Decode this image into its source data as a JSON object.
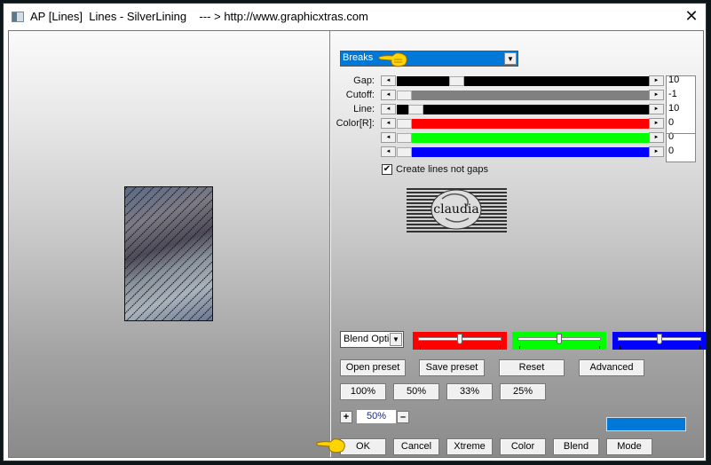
{
  "window": {
    "title": "AP [Lines]  Lines - SilverLining    --- > http://www.graphicxtras.com",
    "close_icon": "close-icon"
  },
  "mode": {
    "selected": "Breaks"
  },
  "sliders": [
    {
      "label": "Gap:",
      "value": "10",
      "fill_color": "#000000",
      "position": 0.22
    },
    {
      "label": "Cutoff:",
      "value": "-1",
      "fill_color": "#808080",
      "position": 0.0
    },
    {
      "label": "Line:",
      "value": "10",
      "fill_color": "#000000",
      "position": 0.05
    },
    {
      "label": "Color[R]:",
      "value": "0",
      "fill_color": "#ff0000",
      "position": 0.0
    },
    {
      "label": "",
      "value": "0",
      "fill_color": "#00ff00",
      "position": 0.0
    },
    {
      "label": "",
      "value": "0",
      "fill_color": "#0000ff",
      "position": 0.0
    }
  ],
  "checkbox": {
    "label": "Create lines not gaps",
    "checked": true
  },
  "logo": {
    "text": "claudia"
  },
  "blend": {
    "selected": "Blend Options",
    "color_sliders": [
      {
        "color": "#ff0000",
        "position": 0.5
      },
      {
        "color": "#00ff00",
        "position": 0.5
      },
      {
        "color": "#0000ff",
        "position": 0.5
      }
    ]
  },
  "preset_buttons": [
    "Open preset",
    "Save preset",
    "Reset",
    "Advanced"
  ],
  "zoom_buttons": [
    "100%",
    "50%",
    "33%",
    "25%"
  ],
  "zoom": {
    "plus": "+",
    "value": "50%",
    "minus": "–"
  },
  "color_swatch": "#0078d7",
  "bottom_buttons": [
    "OK",
    "Cancel",
    "Xtreme",
    "Color",
    "Blend",
    "Mode"
  ]
}
